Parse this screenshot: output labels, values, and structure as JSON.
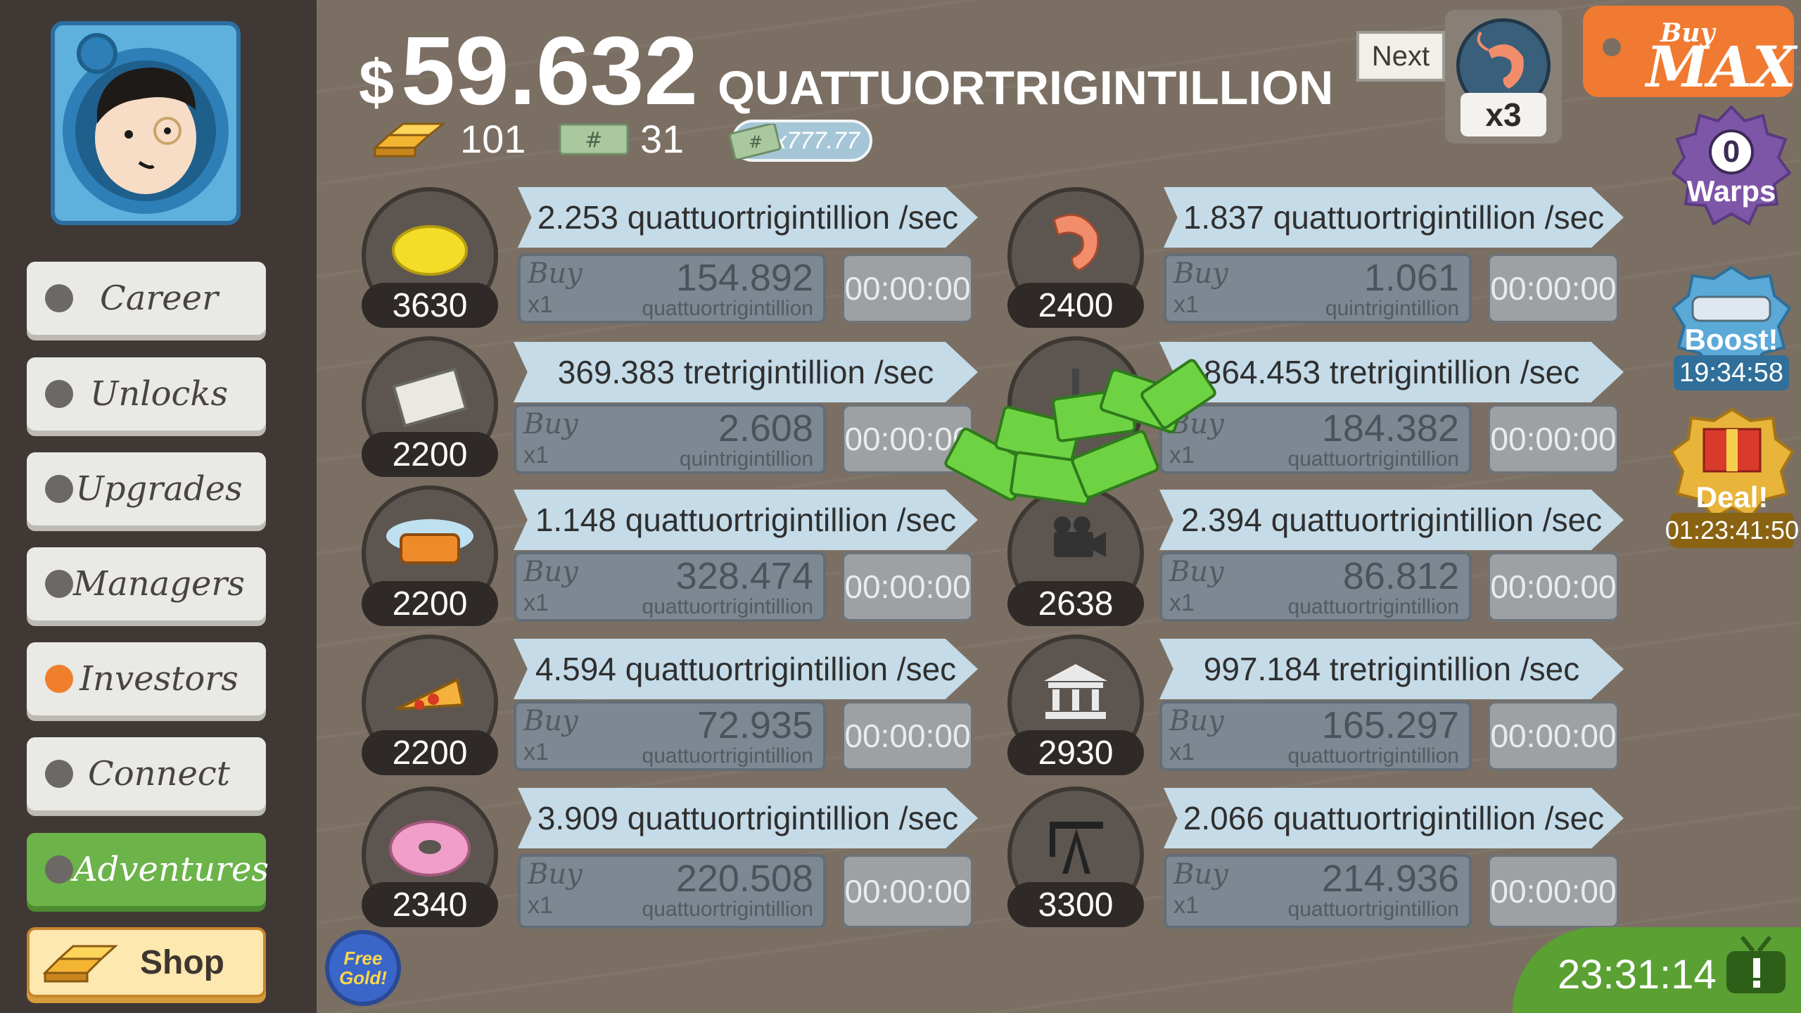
{
  "header": {
    "currency_symbol": "$",
    "money_value": "59.632",
    "money_unit": "QUATTUORTRIGINTILLION",
    "gold_count": "101",
    "megabucks_count": "31",
    "multiplier_label": "x777.77"
  },
  "next_unlock": {
    "label": "Next",
    "multiplier": "x3",
    "icon": "shrimp-icon"
  },
  "buy_max": {
    "line1": "Buy",
    "line2": "MAX"
  },
  "badges": {
    "warps": {
      "count": "0",
      "label": "Warps"
    },
    "boost": {
      "label": "Boost!",
      "timer": "19:34:58"
    },
    "deal": {
      "label": "Deal!",
      "timer": "01:23:41:50"
    }
  },
  "sidebar": {
    "items": [
      {
        "label": "Career"
      },
      {
        "label": "Unlocks"
      },
      {
        "label": "Upgrades"
      },
      {
        "label": "Managers"
      },
      {
        "label": "Investors"
      },
      {
        "label": "Connect"
      },
      {
        "label": "Adventures"
      },
      {
        "label": "Shop"
      }
    ]
  },
  "free_gold": {
    "label": "Free Gold!"
  },
  "footer": {
    "timer": "23:31:14"
  },
  "businesses": [
    {
      "icon": "lemon-icon",
      "count": "3630",
      "rate": "2.253 quattuortrigintillion /sec",
      "buy_label": "Buy",
      "buy_qty": "x1",
      "cost": "154.892",
      "cost_unit": "quattuortrigintillion",
      "timer": "00:00:00"
    },
    {
      "icon": "newspaper-icon",
      "count": "2200",
      "rate": "369.383 tretrigintillion /sec",
      "buy_label": "Buy",
      "buy_qty": "x1",
      "cost": "2.608",
      "cost_unit": "quintrigintillion",
      "timer": "00:00:00"
    },
    {
      "icon": "car-wash-icon",
      "count": "2200",
      "rate": "1.148 quattuortrigintillion /sec",
      "buy_label": "Buy",
      "buy_qty": "x1",
      "cost": "328.474",
      "cost_unit": "quattuortrigintillion",
      "timer": "00:00:00"
    },
    {
      "icon": "pizza-icon",
      "count": "2200",
      "rate": "4.594 quattuortrigintillion /sec",
      "buy_label": "Buy",
      "buy_qty": "x1",
      "cost": "72.935",
      "cost_unit": "quattuortrigintillion",
      "timer": "00:00:00"
    },
    {
      "icon": "donut-icon",
      "count": "2340",
      "rate": "3.909 quattuortrigintillion /sec",
      "buy_label": "Buy",
      "buy_qty": "x1",
      "cost": "220.508",
      "cost_unit": "quattuortrigintillion",
      "timer": "00:00:00"
    },
    {
      "icon": "shrimp-icon",
      "count": "2400",
      "rate": "1.837 quattuortrigintillion /sec",
      "buy_label": "Buy",
      "buy_qty": "x1",
      "cost": "1.061",
      "cost_unit": "quintrigintillion",
      "timer": "00:00:00"
    },
    {
      "icon": "hockey-icon",
      "count": "",
      "rate": "864.453 tretrigintillion /sec",
      "buy_label": "Buy",
      "buy_qty": "x1",
      "cost": "184.382",
      "cost_unit": "quattuortrigintillion",
      "timer": "00:00:00"
    },
    {
      "icon": "movie-camera-icon",
      "count": "2638",
      "rate": "2.394 quattuortrigintillion /sec",
      "buy_label": "Buy",
      "buy_qty": "x1",
      "cost": "86.812",
      "cost_unit": "quattuortrigintillion",
      "timer": "00:00:00"
    },
    {
      "icon": "bank-icon",
      "count": "2930",
      "rate": "997.184 tretrigintillion /sec",
      "buy_label": "Buy",
      "buy_qty": "x1",
      "cost": "165.297",
      "cost_unit": "quattuortrigintillion",
      "timer": "00:00:00"
    },
    {
      "icon": "oil-rig-icon",
      "count": "3300",
      "rate": "2.066 quattuortrigintillion /sec",
      "buy_label": "Buy",
      "buy_qty": "x1",
      "cost": "214.936",
      "cost_unit": "quattuortrigintillion",
      "timer": "00:00:00"
    }
  ]
}
